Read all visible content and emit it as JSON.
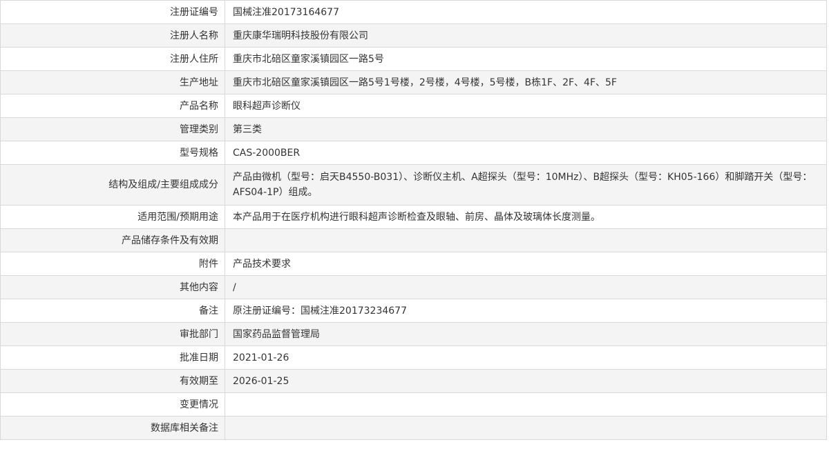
{
  "rows": [
    {
      "label": "注册证编号",
      "value": "国械注准20173164677"
    },
    {
      "label": "注册人名称",
      "value": "重庆康华瑞明科技股份有限公司"
    },
    {
      "label": "注册人住所",
      "value": "重庆市北碚区童家溪镇园区一路5号"
    },
    {
      "label": "生产地址",
      "value": "重庆市北碚区童家溪镇园区一路5号1号楼，2号楼，4号楼，5号楼，B栋1F、2F、4F、5F"
    },
    {
      "label": "产品名称",
      "value": "眼科超声诊断仪"
    },
    {
      "label": "管理类别",
      "value": "第三类"
    },
    {
      "label": "型号规格",
      "value": "CAS-2000BER"
    },
    {
      "label": "结构及组成/主要组成成分",
      "value": "产品由微机（型号：启天B4550-B031）、诊断仪主机、A超探头（型号：10MHz）、B超探头（型号：KH05-166）和脚踏开关（型号：AFS04-1P）组成。"
    },
    {
      "label": "适用范围/预期用途",
      "value": "本产品用于在医疗机构进行眼科超声诊断检查及眼轴、前房、晶体及玻璃体长度测量。"
    },
    {
      "label": "产品储存条件及有效期",
      "value": ""
    },
    {
      "label": "附件",
      "value": "产品技术要求"
    },
    {
      "label": "其他内容",
      "value": "/"
    },
    {
      "label": "备注",
      "value": "原注册证编号：国械注准20173234677"
    },
    {
      "label": "审批部门",
      "value": "国家药品监督管理局"
    },
    {
      "label": "批准日期",
      "value": "2021-01-26"
    },
    {
      "label": "有效期至",
      "value": "2026-01-25"
    },
    {
      "label": "变更情况",
      "value": ""
    },
    {
      "label": "数据库相关备注",
      "value": ""
    }
  ]
}
